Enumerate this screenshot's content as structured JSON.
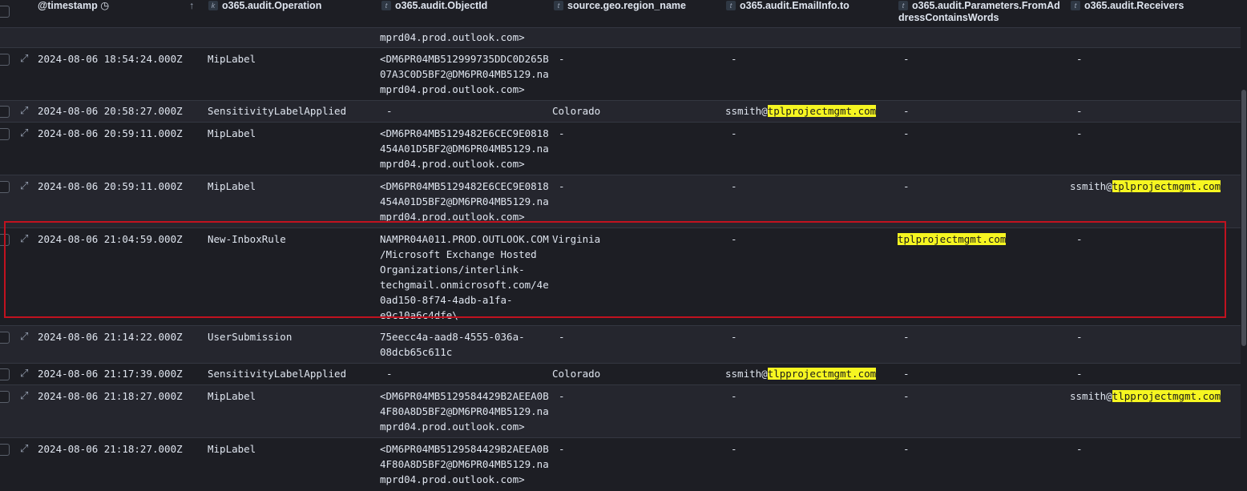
{
  "columns": {
    "timestamp": "@timestamp",
    "operation": "o365.audit.Operation",
    "object_id": "o365.audit.ObjectId",
    "region": "source.geo.region_name",
    "email_to": "o365.audit.EmailInfo.to",
    "from_addr_line1": "o365.audit.Parameters.FromAd",
    "from_addr_line2": "dressContainsWords",
    "receivers": "o365.audit.Receivers"
  },
  "type_badges": {
    "keyword": "k",
    "text": "t"
  },
  "sort_indicator": "↑",
  "expand_glyph": "⤢",
  "top_partial": {
    "object_id": "mprd04.prod.outlook.com>"
  },
  "rows": [
    {
      "timestamp": "2024-08-06 18:54:24.000Z",
      "operation": "MipLabel",
      "object_id": "<DM6PR04MB512999735DDC0D265B\n07A3C0D5BF2@DM6PR04MB5129.na\nmprd04.prod.outlook.com>",
      "region": "-",
      "email_to": "-",
      "from_addr": "-",
      "receivers": "-"
    },
    {
      "timestamp": "2024-08-06 20:58:27.000Z",
      "operation": "SensitivityLabelApplied",
      "object_id": "-",
      "region": "Colorado",
      "email_to_prefix": "ssmith@",
      "email_to_hl": "tplprojectmgmt.com",
      "from_addr": "-",
      "receivers": "-"
    },
    {
      "timestamp": "2024-08-06 20:59:11.000Z",
      "operation": "MipLabel",
      "object_id": "<DM6PR04MB5129482E6CEC9E0818\n454A01D5BF2@DM6PR04MB5129.na\nmprd04.prod.outlook.com>",
      "region": "-",
      "email_to": "-",
      "from_addr": "-",
      "receivers": "-"
    },
    {
      "timestamp": "2024-08-06 20:59:11.000Z",
      "operation": "MipLabel",
      "object_id": "<DM6PR04MB5129482E6CEC9E0818\n454A01D5BF2@DM6PR04MB5129.na\nmprd04.prod.outlook.com>",
      "region": "-",
      "email_to": "-",
      "from_addr": "-",
      "receivers_prefix": "ssmith@",
      "receivers_hl": "tplprojectmgmt.com"
    },
    {
      "timestamp": "2024-08-06 21:04:59.000Z",
      "operation": "New-InboxRule",
      "object_id": "NAMPR04A011.PROD.OUTLOOK.COM\n/Microsoft Exchange Hosted\nOrganizations/interlink-\ntechgmail.onmicrosoft.com/4e\n0ad150-8f74-4adb-a1fa-\ne9c10a6c4dfe\\",
      "region": "Virginia",
      "email_to": "-",
      "from_addr_hl": "tplprojectmgmt.com",
      "receivers": "-"
    },
    {
      "timestamp": "2024-08-06 21:14:22.000Z",
      "operation": "UserSubmission",
      "object_id": "75eecc4a-aad8-4555-036a-\n08dcb65c611c",
      "region": "-",
      "email_to": "-",
      "from_addr": "-",
      "receivers": "-"
    },
    {
      "timestamp": "2024-08-06 21:17:39.000Z",
      "operation": "SensitivityLabelApplied",
      "object_id": "-",
      "region": "Colorado",
      "email_to_prefix": "ssmith@",
      "email_to_hl": "tlpprojectmgmt.com",
      "from_addr": "-",
      "receivers": "-"
    },
    {
      "timestamp": "2024-08-06 21:18:27.000Z",
      "operation": "MipLabel",
      "object_id": "<DM6PR04MB5129584429B2AEEA0B\n4F80A8D5BF2@DM6PR04MB5129.na\nmprd04.prod.outlook.com>",
      "region": "-",
      "email_to": "-",
      "from_addr": "-",
      "receivers_prefix": "ssmith@",
      "receivers_hl": "tlpprojectmgmt.com"
    },
    {
      "timestamp": "2024-08-06 21:18:27.000Z",
      "operation": "MipLabel",
      "object_id": "<DM6PR04MB5129584429B2AEEA0B\n4F80A8D5BF2@DM6PR04MB5129.na\nmprd04.prod.outlook.com>",
      "region": "-",
      "email_to": "-",
      "from_addr": "-",
      "receivers": "-"
    }
  ],
  "colors": {
    "highlight": "#f6f621",
    "selection_border": "#c1121f",
    "background": "#1d1e24"
  }
}
